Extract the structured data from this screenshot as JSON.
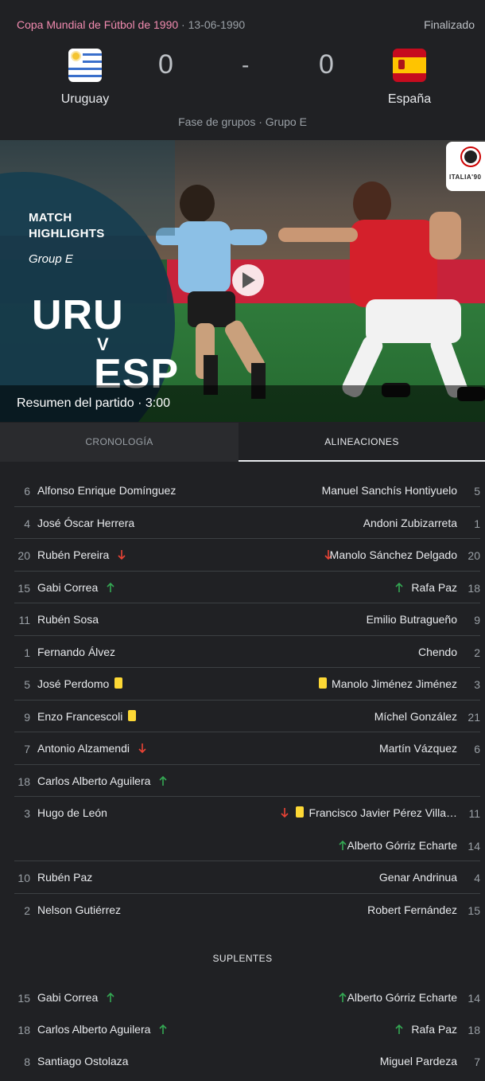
{
  "header": {
    "competition": "Copa Mundial de Fútbol de 1990",
    "date": " · 13-06-1990",
    "status": "Finalizado",
    "home_team": "Uruguay",
    "away_team": "España",
    "home_score": "0",
    "separator": "-",
    "away_score": "0",
    "phase": "Fase de grupos · Grupo E"
  },
  "video": {
    "title_line1": "MATCH",
    "title_line2": "HIGHLIGHTS",
    "group": "Group E",
    "home_code": "URU",
    "vs": "V",
    "away_code": "ESP",
    "logo_text": "ITALIA'90",
    "caption": "Resumen del partido · 3:00"
  },
  "tabs": {
    "timeline": "CRONOLOGÍA",
    "lineups": "ALINEACIONES"
  },
  "colors": {
    "accent_link": "#f28bb0",
    "sub_out": "#ea4335",
    "sub_in": "#34a853",
    "yellow_card": "#fdd835"
  },
  "lineups": [
    {
      "home_num": "6",
      "home_name": "Alfonso Enrique Domínguez",
      "away_name": "Manuel Sanchís Hontiyuelo",
      "away_num": "5"
    },
    {
      "home_num": "4",
      "home_name": "José Óscar Herrera",
      "away_name": "Andoni Zubizarreta",
      "away_num": "1"
    },
    {
      "home_num": "20",
      "home_name": "Rubén Pereira",
      "away_name": "Manolo Sánchez Delgado",
      "away_num": "20"
    },
    {
      "home_num": "15",
      "home_name": "Gabi Correa",
      "away_name": "Rafa Paz",
      "away_num": "18"
    },
    {
      "home_num": "11",
      "home_name": "Rubén Sosa",
      "away_name": "Emilio Butragueño",
      "away_num": "9"
    },
    {
      "home_num": "1",
      "home_name": "Fernando Álvez",
      "away_name": "Chendo",
      "away_num": "2"
    },
    {
      "home_num": "5",
      "home_name": "José Perdomo",
      "away_name": "Manolo Jiménez Jiménez",
      "away_num": "3"
    },
    {
      "home_num": "9",
      "home_name": "Enzo Francescoli",
      "away_name": "Míchel González",
      "away_num": "21"
    },
    {
      "home_num": "7",
      "home_name": "Antonio Alzamendi",
      "away_name": "Martín Vázquez",
      "away_num": "6"
    },
    {
      "home_num": "18",
      "home_name": "Carlos Alberto Aguilera"
    },
    {
      "home_num": "3",
      "home_name": "Hugo de León",
      "away_name": "Francisco Javier Pérez Villa…",
      "away_num": "11"
    },
    {
      "away_name": "Alberto Górriz Echarte",
      "away_num": "14"
    },
    {
      "home_num": "10",
      "home_name": "Rubén Paz",
      "away_name": "Genar Andrinua",
      "away_num": "4"
    },
    {
      "home_num": "2",
      "home_name": "Nelson Gutiérrez",
      "away_name": "Robert Fernández",
      "away_num": "15"
    }
  ],
  "subs_title": "SUPLENTES",
  "subs": [
    {
      "home_num": "15",
      "home_name": "Gabi Correa",
      "away_name": "Alberto Górriz Echarte",
      "away_num": "14"
    },
    {
      "home_num": "18",
      "home_name": "Carlos Alberto Aguilera",
      "away_name": "Rafa Paz",
      "away_num": "18"
    },
    {
      "home_num": "8",
      "home_name": "Santiago Ostolaza",
      "away_name": "Miguel Pardeza",
      "away_num": "7"
    }
  ]
}
